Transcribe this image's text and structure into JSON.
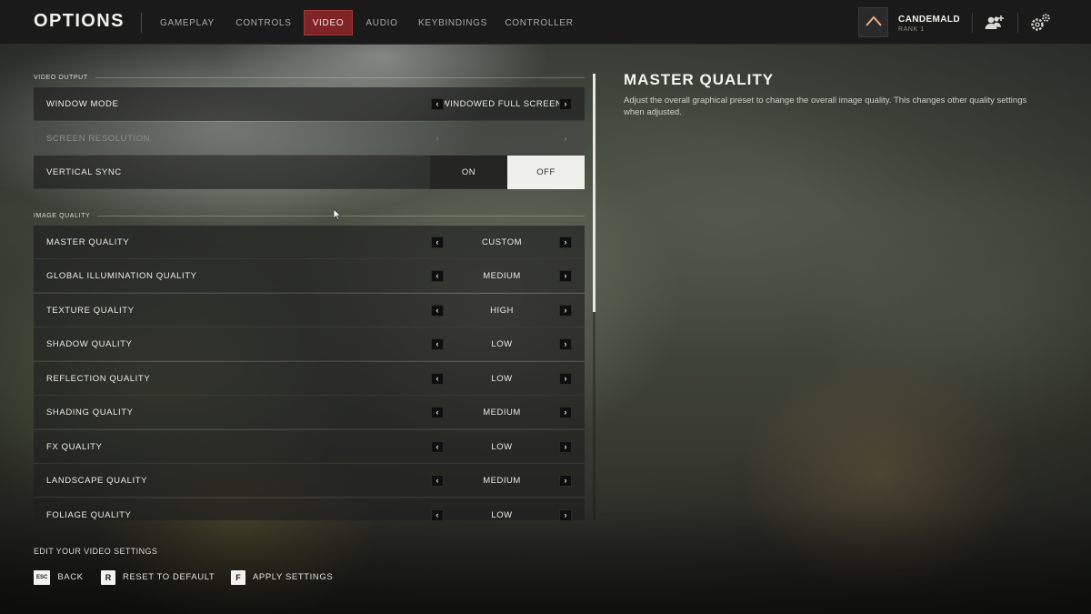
{
  "header": {
    "title": "OPTIONS",
    "tabs": [
      {
        "label": "GAMEPLAY",
        "active": false
      },
      {
        "label": "CONTROLS",
        "active": false
      },
      {
        "label": "VIDEO",
        "active": true
      },
      {
        "label": "AUDIO",
        "active": false
      },
      {
        "label": "KEYBINDINGS",
        "active": false
      },
      {
        "label": "CONTROLLER",
        "active": false
      }
    ],
    "account": {
      "name": "CANDEMALD",
      "rank": "RANK 1",
      "icon": "rank-chevron-icon"
    },
    "icons": [
      "add-friend-icon",
      "settings-gear-icon"
    ]
  },
  "sections": {
    "video_output": "VIDEO OUTPUT",
    "image_quality": "IMAGE QUALITY"
  },
  "video_output": {
    "window_mode": {
      "label": "WINDOW MODE",
      "value": "WINDOWED FULL SCREEN"
    },
    "screen_resolution": {
      "label": "SCREEN RESOLUTION",
      "value": "",
      "disabled": true
    },
    "vertical_sync": {
      "label": "VERTICAL SYNC",
      "on_label": "ON",
      "off_label": "OFF",
      "selected": "OFF"
    }
  },
  "image_quality": [
    {
      "label": "MASTER QUALITY",
      "value": "CUSTOM"
    },
    {
      "label": "GLOBAL ILLUMINATION QUALITY",
      "value": "MEDIUM"
    },
    {
      "label": "TEXTURE QUALITY",
      "value": "HIGH"
    },
    {
      "label": "SHADOW QUALITY",
      "value": "LOW"
    },
    {
      "label": "REFLECTION QUALITY",
      "value": "LOW"
    },
    {
      "label": "SHADING QUALITY",
      "value": "MEDIUM"
    },
    {
      "label": "FX QUALITY",
      "value": "LOW"
    },
    {
      "label": "LANDSCAPE QUALITY",
      "value": "MEDIUM"
    },
    {
      "label": "FOLIAGE QUALITY",
      "value": "LOW"
    }
  ],
  "description": {
    "title": "MASTER QUALITY",
    "text": "Adjust the overall graphical preset to change the overall image quality. This changes other quality settings when adjusted."
  },
  "footer": {
    "hint": "EDIT YOUR VIDEO SETTINGS",
    "actions": [
      {
        "key": "ESC",
        "label": "BACK"
      },
      {
        "key": "R",
        "label": "RESET TO DEFAULT"
      },
      {
        "key": "F",
        "label": "APPLY SETTINGS"
      }
    ]
  },
  "colors": {
    "accent": "#7e2426",
    "topbar": "#1a1a1a",
    "toggle_selected": "#efefec"
  }
}
